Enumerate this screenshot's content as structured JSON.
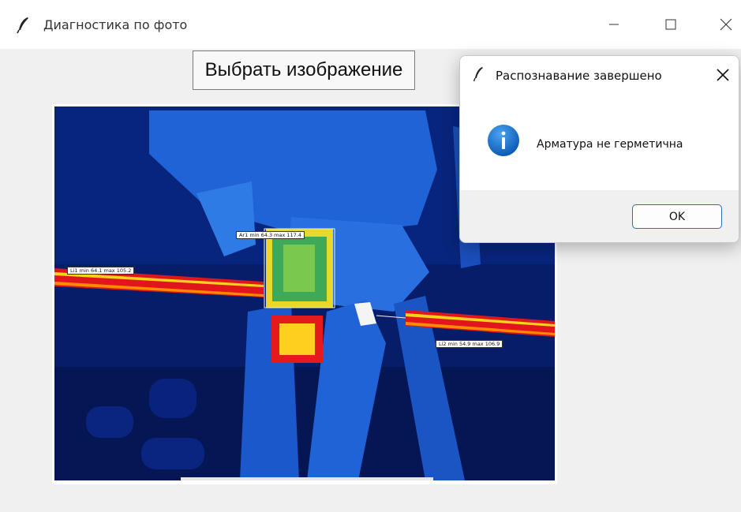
{
  "window": {
    "title": "Диагностика по фото",
    "icon": "feather-icon",
    "controls": [
      "minimize-icon",
      "maximize-icon",
      "close-icon"
    ]
  },
  "toolbar": {
    "choose_image_label": "Выбрать изображение"
  },
  "thermal_image": {
    "labels": {
      "ar1": "Ar1 min 64.3 max 117.4",
      "li1": "Li1 min 64.1 max 105.2",
      "li2": "Li2 min 54.9 max 106.9"
    }
  },
  "dialog": {
    "title": "Распознавание завершено",
    "title_icon": "feather-icon",
    "icon": "info-icon",
    "message": "Арматура не герметична",
    "ok_label": "OK",
    "accent": "#2a6bc6"
  }
}
